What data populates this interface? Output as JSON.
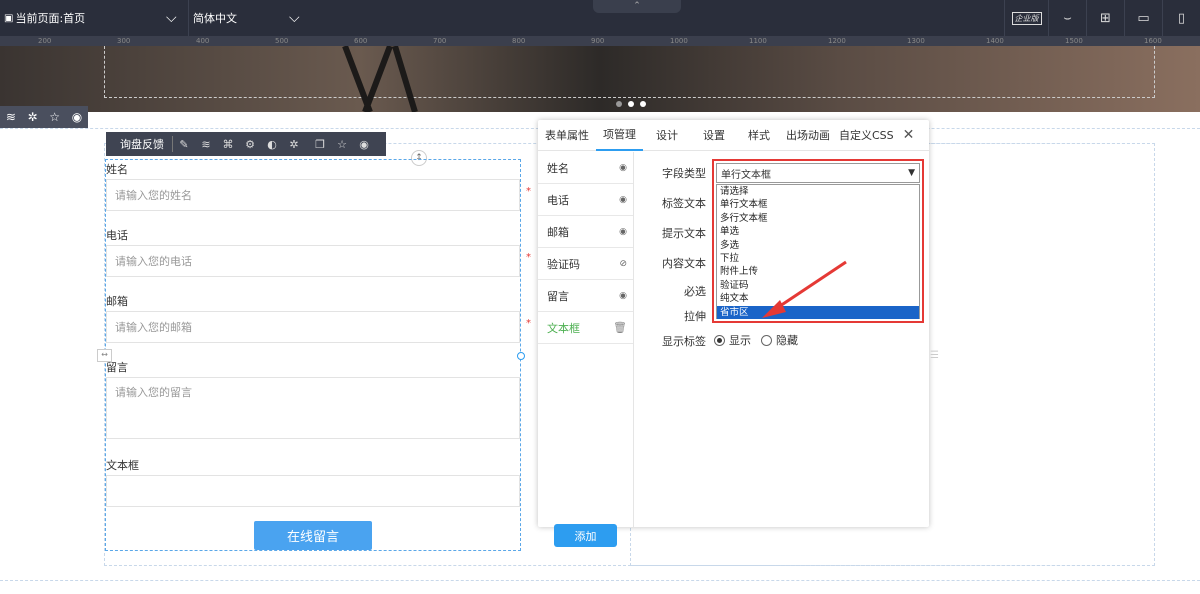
{
  "topbar": {
    "current_page": "当前页面:首页",
    "language": "简体中文",
    "enterprise": "企业版"
  },
  "ruler": [
    "200",
    "300",
    "400",
    "500",
    "600",
    "700",
    "800",
    "900",
    "1000",
    "1100",
    "1200",
    "1300",
    "1400",
    "1500",
    "1600"
  ],
  "canvas_toolbar": {
    "label": "询盘反馈"
  },
  "form": {
    "fields": [
      {
        "label": "姓名",
        "placeholder": "请输入您的姓名",
        "required": "*"
      },
      {
        "label": "电话",
        "placeholder": "请输入您的电话",
        "required": "*"
      },
      {
        "label": "邮箱",
        "placeholder": "请输入您的邮箱",
        "required": "*"
      },
      {
        "label": "留言",
        "placeholder": "请输入您的留言",
        "required": ""
      },
      {
        "label": "文本框",
        "placeholder": "",
        "required": ""
      }
    ],
    "submit_label": "在线留言"
  },
  "panel": {
    "tabs": [
      "表单属性",
      "项管理",
      "设计",
      "设置",
      "样式",
      "出场动画",
      "自定义CSS"
    ],
    "active_tab": "项管理",
    "items": [
      {
        "label": "姓名",
        "icon": "eye-icon"
      },
      {
        "label": "电话",
        "icon": "eye-icon"
      },
      {
        "label": "邮箱",
        "icon": "eye-icon"
      },
      {
        "label": "验证码",
        "icon": "eye-off-icon"
      },
      {
        "label": "留言",
        "icon": "eye-icon"
      },
      {
        "label": "文本框",
        "icon": "trash-icon"
      }
    ],
    "add_label": "添加",
    "props": {
      "field_type_label": "字段类型",
      "label_text": "标签文本",
      "hint_text": "提示文本",
      "content_text": "内容文本",
      "required": "必选",
      "stretch": "拉伸",
      "show_label": "显示标签",
      "show": "显示",
      "hide": "隐藏"
    },
    "select_value": "单行文本框",
    "options": [
      "请选择",
      "单行文本框",
      "多行文本框",
      "单选",
      "多选",
      "下拉",
      "附件上传",
      "验证码",
      "纯文本",
      "省市区"
    ],
    "selected_option": "省市区"
  },
  "colors": {
    "accent": "#2d9df0",
    "highlight": "#e53935",
    "topbar": "#2a2e3b"
  }
}
